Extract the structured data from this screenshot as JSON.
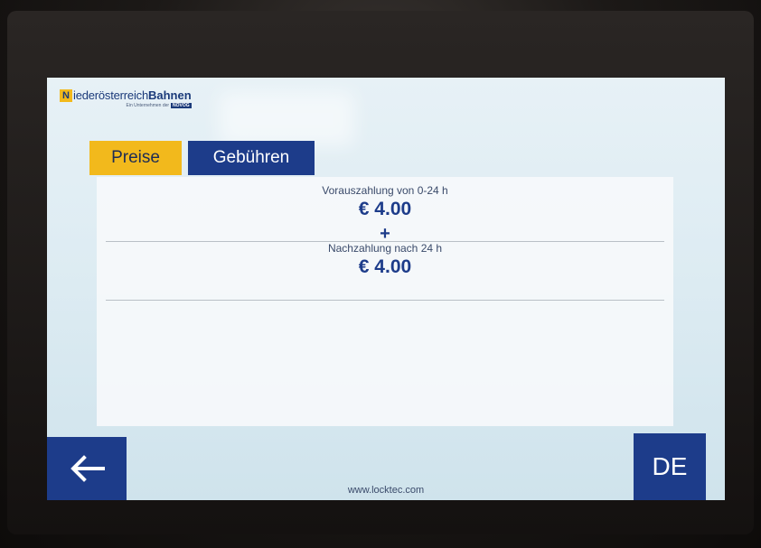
{
  "header": {
    "logo_n": "N",
    "logo_text": "iederösterreich",
    "logo_bold": "Bahnen",
    "logo_sub": "Ein Unternehmen der",
    "logo_sub_brand": "NÖVOG"
  },
  "tabs": [
    {
      "label": "Preise",
      "color": "#f2b91c"
    },
    {
      "label": "Gebühren",
      "color": "#1d3c8a"
    }
  ],
  "fees": {
    "prepay_label": "Vorauszahlung von 0-24 h",
    "prepay_price": "€ 4.00",
    "plus": "+",
    "postpay_label": "Nachzahlung nach 24 h",
    "postpay_price": "€ 4.00"
  },
  "nav": {
    "back_icon": "arrow-left-icon",
    "language": "DE"
  },
  "footer": {
    "url": "www.locktec.com"
  },
  "colors": {
    "brand_blue": "#1d3c8a",
    "brand_yellow": "#f2b91c"
  }
}
